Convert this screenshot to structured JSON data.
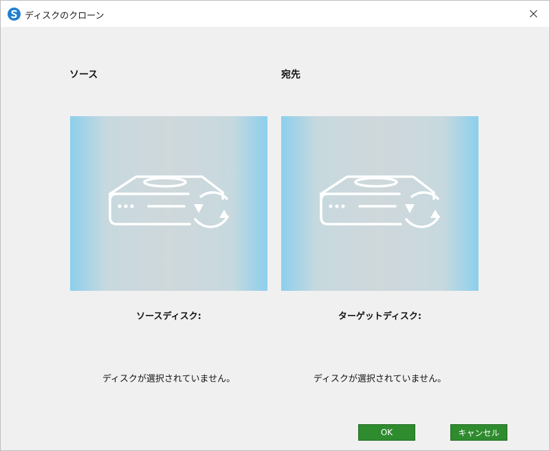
{
  "window": {
    "title": "ディスクのクローン",
    "icon": "app-logo-icon",
    "close_icon": "close-icon"
  },
  "source": {
    "label": "ソース",
    "disk_title": "ソースディスク:",
    "status": "ディスクが選択されていません。",
    "icon": "hard-drive-sync-icon"
  },
  "destination": {
    "label": "宛先",
    "disk_title": "ターゲットディスク:",
    "status": "ディスクが選択されていません。",
    "icon": "hard-drive-sync-icon"
  },
  "buttons": {
    "ok": "OK",
    "cancel": "キャンセル"
  },
  "colors": {
    "button_green": "#2e8b2e",
    "panel_edge_blue": "#8ccfec",
    "app_icon_blue": "#1f7fd1"
  }
}
